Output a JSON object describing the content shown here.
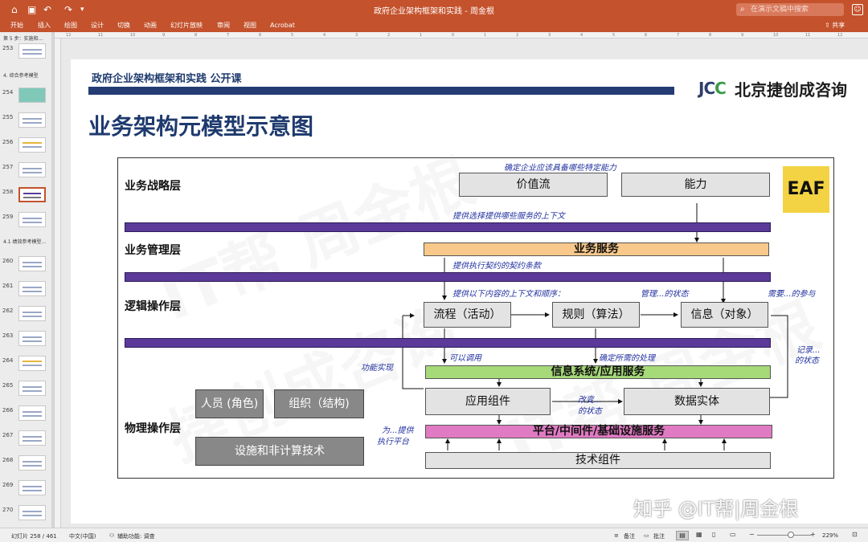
{
  "window": {
    "doc_title": "政府企业架构框架和实践 - 周金根",
    "search_placeholder": "在演示文稿中搜索"
  },
  "ribbon": {
    "tabs": [
      "开始",
      "插入",
      "绘图",
      "设计",
      "切换",
      "动画",
      "幻灯片放映",
      "审阅",
      "视图",
      "Acrobat"
    ],
    "share_label": "共享"
  },
  "thumbnails": {
    "sections": [
      "第 5 步：实施和...",
      "4. 综合参考模型",
      "4.1 绩效参考模型..."
    ],
    "slides": [
      "253",
      "254",
      "255",
      "256",
      "257",
      "258",
      "259",
      "260",
      "261",
      "262",
      "263",
      "264",
      "265",
      "266",
      "267",
      "268",
      "269",
      "270"
    ],
    "selected": "258"
  },
  "ruler": {
    "marks": [
      "12",
      "11",
      "10",
      "9",
      "8",
      "7",
      "6",
      "5",
      "4",
      "3",
      "2",
      "1",
      "0",
      "1",
      "2",
      "3",
      "4",
      "5",
      "6",
      "7",
      "8",
      "9",
      "10",
      "11",
      "12"
    ]
  },
  "slide": {
    "course_title": "政府企业架构框架和实践 公开课",
    "logo_mark": "JCC",
    "logo_text": "北京捷创成咨询",
    "main_title": "业务架构元模型示意图",
    "diagram": {
      "layers": {
        "strategy": "业务战略层",
        "management": "业务管理层",
        "logical": "逻辑操作层",
        "physical": "物理操作层"
      },
      "boxes": {
        "value_stream": "价值流",
        "capability": "能力",
        "process": "流程（活动）",
        "rules": "规则（算法）",
        "information": "信息（对象）",
        "app_component": "应用组件",
        "data_entity": "数据实体",
        "people": "人员 (角色)",
        "organization": "组织（结构)",
        "facilities": "设施和非计算技术",
        "tech_component": "技术组件"
      },
      "services": {
        "business_service": "业务服务",
        "info_system_service": "信息系统/应用服务",
        "platform_service": "平台/中间件/基础设施服务"
      },
      "notes": {
        "n1": "确定企业应该具备哪些特定能力",
        "n2": "提供选择提供哪些服务的上下文",
        "n3": "提供执行契约的契约条款",
        "n4": "提供以下内容的上下文和顺序：",
        "n5": "管理...的状态",
        "n6": "需要...的参与",
        "n7": "可以调用",
        "n8": "确定所需的处理",
        "n9": "功能实现",
        "n10a": "记录...",
        "n10b": "的状态",
        "n11a": "改变...",
        "n11b": "的状态",
        "n12a": "为...提供",
        "n12b": "执行平台"
      },
      "eaf_label": "EAF",
      "watermark": [
        "IT帮 周金根",
        "捷创成咨询",
        "IT帮 周金根"
      ]
    },
    "zhihu_watermark": "知乎 @IT帮|周金根"
  },
  "statusbar": {
    "slide_pos": "幻灯片 258 / 461",
    "language": "中文(中国)",
    "accessibility": "辅助功能: 调查",
    "notes": "备注",
    "comments": "批注",
    "zoom": "229%"
  },
  "colors": {
    "ribbon": "#c4522c",
    "title_blue": "#1e3a6e",
    "purple_bar": "#5b3a9a",
    "business_service": "#f8c98b",
    "info_service": "#a6d978",
    "platform_service": "#e07ac3",
    "eaf_yellow": "#f3d243"
  }
}
